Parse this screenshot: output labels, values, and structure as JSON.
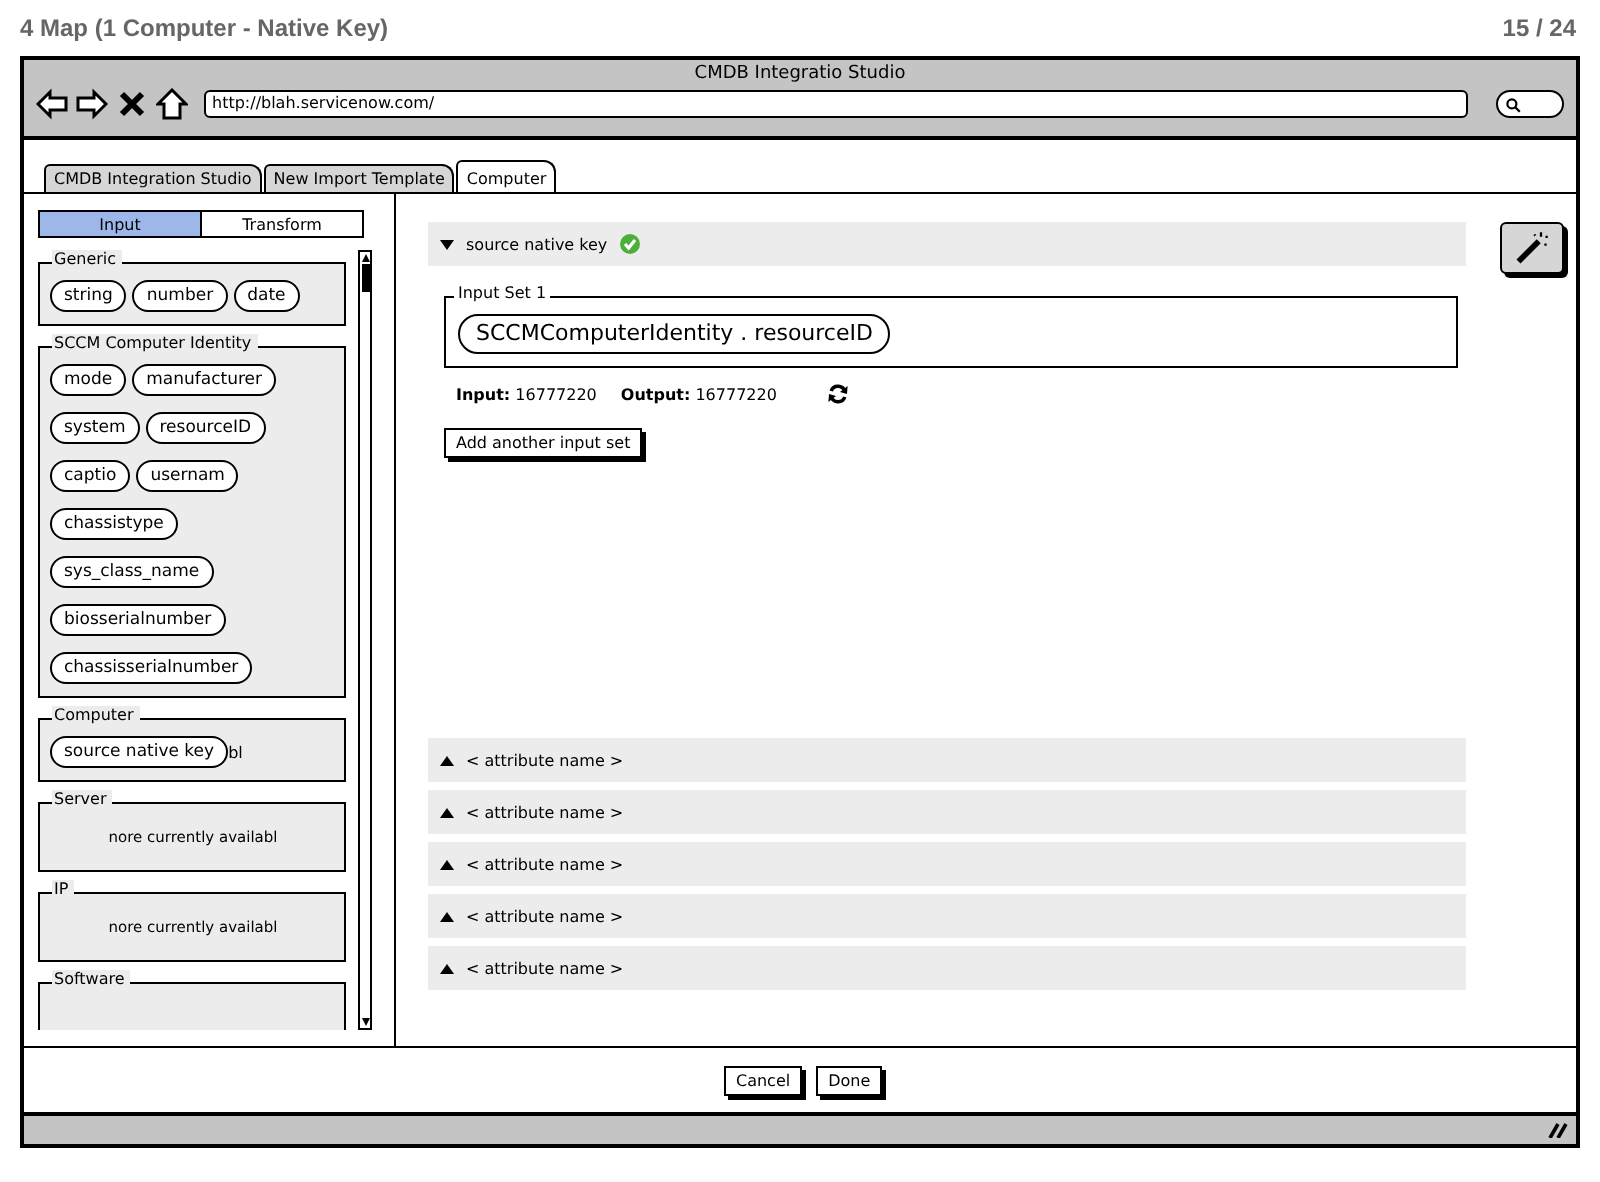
{
  "page": {
    "title": "4 Map (1 Computer - Native Key)",
    "counter": "15 / 24"
  },
  "window": {
    "title": "CMDB Integratio Studio",
    "url": "http://blah.servicenow.com/"
  },
  "tabs": [
    {
      "label": "CMDB Integration Studio",
      "selected": false
    },
    {
      "label": "New Import Template",
      "selected": false
    },
    {
      "label": "Computer",
      "selected": true
    }
  ],
  "mode_toggle": [
    {
      "label": "Input",
      "selected": true
    },
    {
      "label": "Transform",
      "selected": false
    }
  ],
  "groups": [
    {
      "title": "Generic",
      "kind": "pills",
      "items": [
        "string",
        "number",
        "date"
      ]
    },
    {
      "title": "SCCM Computer Identity",
      "kind": "pills",
      "items": [
        "mode",
        "manufacturer",
        "system",
        "resourceID",
        "captio",
        "usernam",
        "chassistype",
        "sys_class_name",
        "biosserialnumber",
        "chassisserialnumber"
      ]
    },
    {
      "title": "Computer",
      "kind": "pills",
      "items": [
        "source native key"
      ],
      "trailing": "bl"
    },
    {
      "title": "Server",
      "kind": "message",
      "message": "nore currently availabl"
    },
    {
      "title": "IP",
      "kind": "message",
      "message": "nore currently availabl"
    },
    {
      "title": "Software",
      "kind": "message"
    }
  ],
  "attribute": {
    "name": "source native key",
    "expanded": true,
    "valid": true
  },
  "input_sets": [
    {
      "title": "Input Set 1",
      "items": [
        "SCCMComputerIdentity . resourceID"
      ]
    }
  ],
  "result": {
    "input_label": "Input:",
    "input_value": "16777220",
    "output_label": "Output:",
    "output_value": "16777220"
  },
  "add_button": "Add another input set",
  "other_attributes": [
    {
      "name": "< attribute name >",
      "expanded": false
    },
    {
      "name": "< attribute name >",
      "expanded": false
    },
    {
      "name": "< attribute name >",
      "expanded": false
    },
    {
      "name": "< attribute name >",
      "expanded": false
    },
    {
      "name": "< attribute name >",
      "expanded": false
    }
  ],
  "buttons": [
    "Cancel",
    "Done"
  ]
}
